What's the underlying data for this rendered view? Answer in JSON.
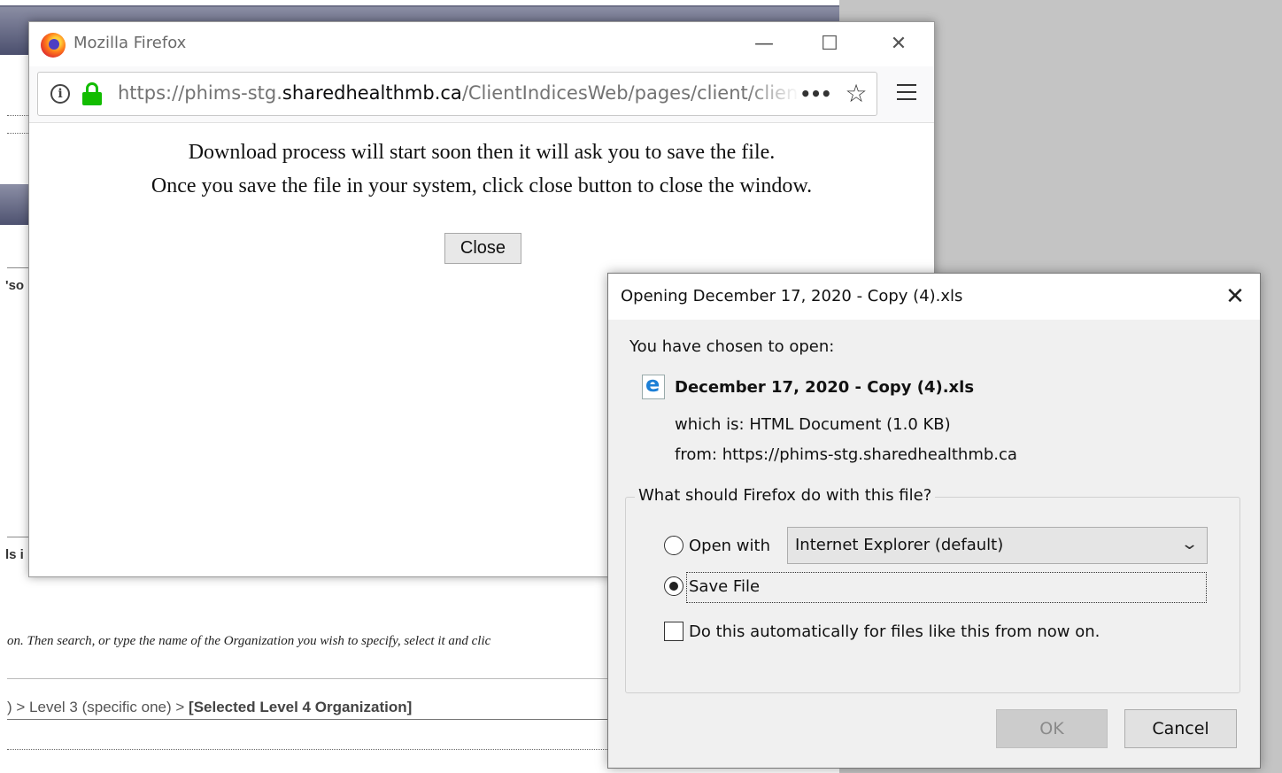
{
  "background": {
    "fragment_person": "'so",
    "fragment_is": "ls i",
    "instructions_italic": "on. Then search, or type the name of the Organization you wish to specify, select it and clic",
    "breadcrumb_prefix": ") > Level 3 (specific one) > ",
    "breadcrumb_selected": "[Selected Level 4 Organization]"
  },
  "firefox_window": {
    "title": "Mozilla Firefox",
    "controls": {
      "minimize": "—",
      "maximize": "☐",
      "close": "✕"
    },
    "url_prefix": "https://phims-stg.",
    "url_domain": "sharedhealthmb.ca",
    "url_path": "/ClientIndicesWeb/pages/client/clien",
    "page_actions_glyph": "•••",
    "bookmark_glyph": "☆",
    "message_line1": "Download process will start soon then it will ask you to save the file.",
    "message_line2": "Once you save the file in your system, click close button to close the window.",
    "close_button": "Close"
  },
  "open_dialog": {
    "title": "Opening December 17, 2020 - Copy (4).xls",
    "close_glyph": "✕",
    "chosen_label": "You have chosen to open:",
    "file_name": "December 17, 2020 - Copy (4).xls",
    "which_is_label": "which is:",
    "which_is_value": "HTML Document (1.0 KB)",
    "from_label": "from:",
    "from_value": "https://phims-stg.sharedhealthmb.ca",
    "question": "What should Firefox do with this file?",
    "open_with_label": "Open with",
    "open_with_value": "Internet Explorer (default)",
    "save_file_label": "Save File",
    "auto_label": "Do this automatically for files like this from now on.",
    "ok_button": "OK",
    "cancel_button": "Cancel",
    "selected_action": "save"
  }
}
